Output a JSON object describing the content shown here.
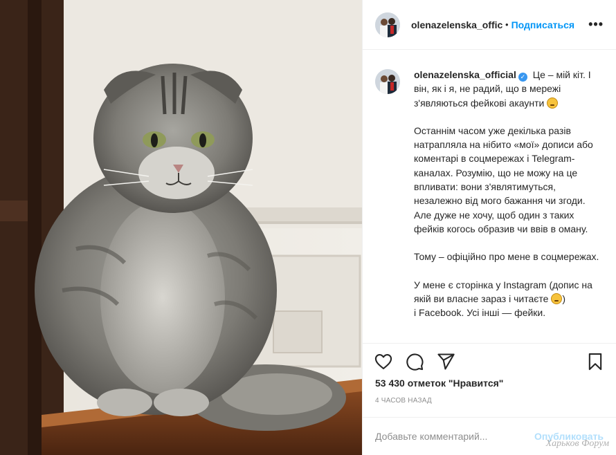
{
  "post": {
    "username": "olenazelenska_offic",
    "dot": "•",
    "follow_label": "Подписаться",
    "more_label": "•••"
  },
  "caption": {
    "username": "olenazelenska_official",
    "verified_mark": "✓",
    "line1": "Це – мій кіт. І він, як і я, не радий, що в мережі з'являються фейкові акаунти",
    "para2": "Останнім часом уже декілька разів натрапляла на нібито «мої» дописи або коментарі в соцмережах і Telegram-каналах. Розумію, що не можу на це впливати: вони з'являтимуться, незалежно від мого бажання чи згоди. Але дуже не хочу, щоб один з таких фейків когось образив чи ввів в оману.",
    "para3": "Тому – офіційно про мене в соцмережах.",
    "para4": "У мене є сторінка у Instagram (допис на якій ви власне зараз і читаєте",
    "para4_end": ")",
    "para5_partial": "і Facebook. Усі інші — фейки."
  },
  "icons": {
    "like": "heart-icon",
    "comment": "comment-icon",
    "share": "share-icon",
    "save": "bookmark-icon",
    "angry_emoji": "angry-face-emoji",
    "smile_emoji": "smiling-face-emoji"
  },
  "stats": {
    "likes": "53 430 отметок \"Нравится\"",
    "time": "4 ЧАСОВ НАЗАД"
  },
  "comment": {
    "placeholder": "Добавьте комментарий...",
    "publish_label": "Опубликовать"
  },
  "watermark": "Харьков Форум",
  "colors": {
    "link_blue": "#0095f6",
    "publish_disabled": "#b2dffc",
    "muted": "#8e8e8e",
    "text": "#262626"
  }
}
